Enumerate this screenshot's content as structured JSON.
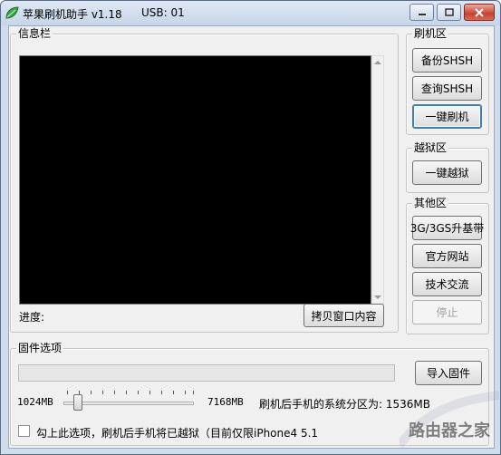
{
  "window": {
    "title": "苹果刷机助手 v1.18",
    "usb_label": "USB: 01"
  },
  "info": {
    "group_label": "信息栏",
    "progress_label": "进度:",
    "copy_button": "拷贝窗口内容"
  },
  "flash": {
    "group_label": "刷机区",
    "backup_shsh": "备份SHSH",
    "query_shsh": "查询SHSH",
    "one_click_flash": "一键刷机"
  },
  "jailbreak": {
    "group_label": "越狱区",
    "one_click_jailbreak": "一键越狱"
  },
  "other": {
    "group_label": "其他区",
    "baseband": "3G/3GS升基带",
    "website": "官方网站",
    "tech_exchange": "技术交流",
    "stop": "停止"
  },
  "firmware": {
    "group_label": "固件选项",
    "import_button": "导入固件",
    "min_size": "1024MB",
    "max_size": "7168MB",
    "partition_text": "刷机后手机的系统分区为: 1536MB",
    "slider_value_mb": 1536,
    "jailbreak_checkbox_label": "勾上此选项，刷机后手机将已越狱（目前仅限iPhone4 5.1",
    "jailbreak_checked": false
  },
  "watermark": {
    "text": "路由器之家"
  },
  "colors": {
    "console_bg": "#000000",
    "client_bg": "#f0f0f0",
    "frame": "#cfdcec",
    "close_button": "#c7422f"
  }
}
